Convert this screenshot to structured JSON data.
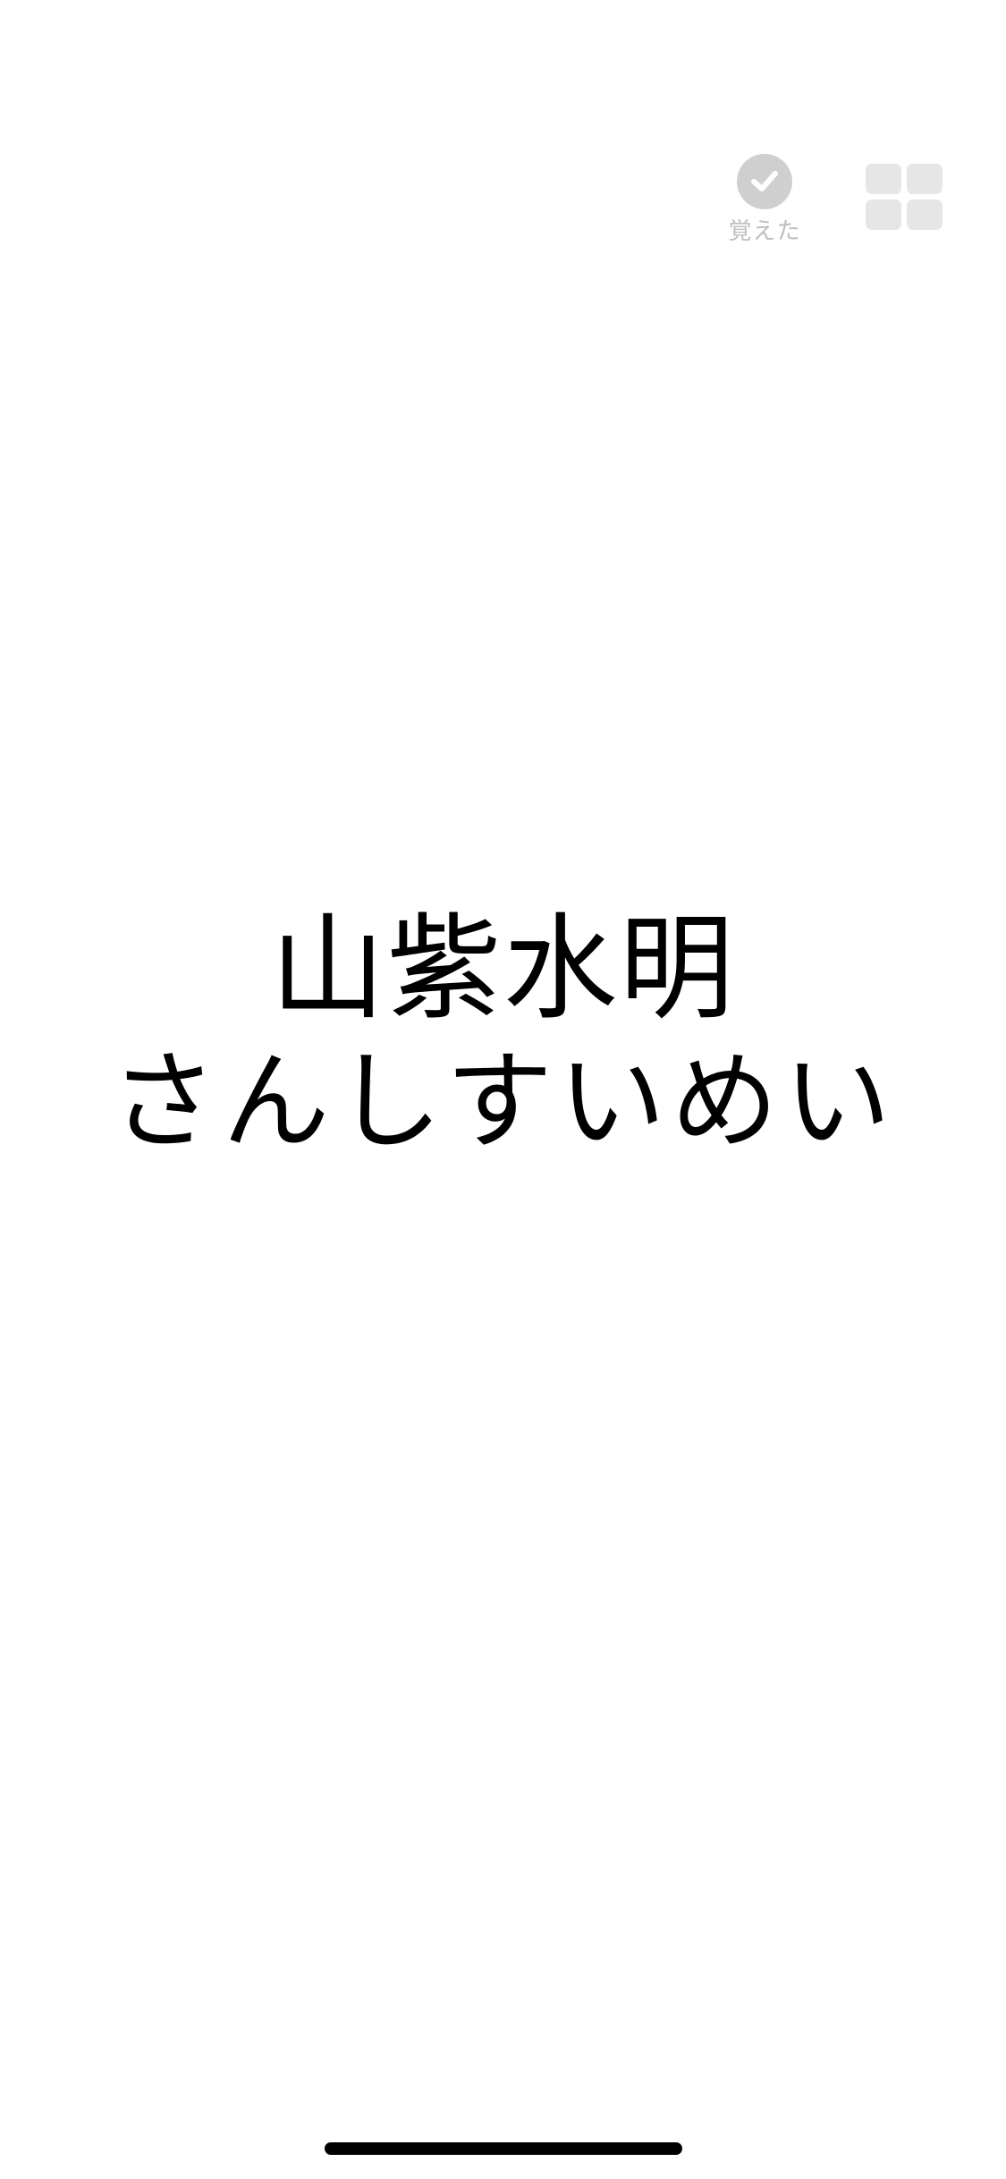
{
  "toolbar": {
    "memorized_label": "覚えた",
    "memorized_icon": "check-circle-icon",
    "grid_icon": "grid-icon"
  },
  "card": {
    "kanji": "山紫水明",
    "reading": "さんしすいめい"
  },
  "colors": {
    "background": "#ffffff",
    "text": "#000000",
    "icon_inactive": "#cfcfcf",
    "label_inactive": "#bdbdbd",
    "grid_tile": "#e6e6e6"
  }
}
